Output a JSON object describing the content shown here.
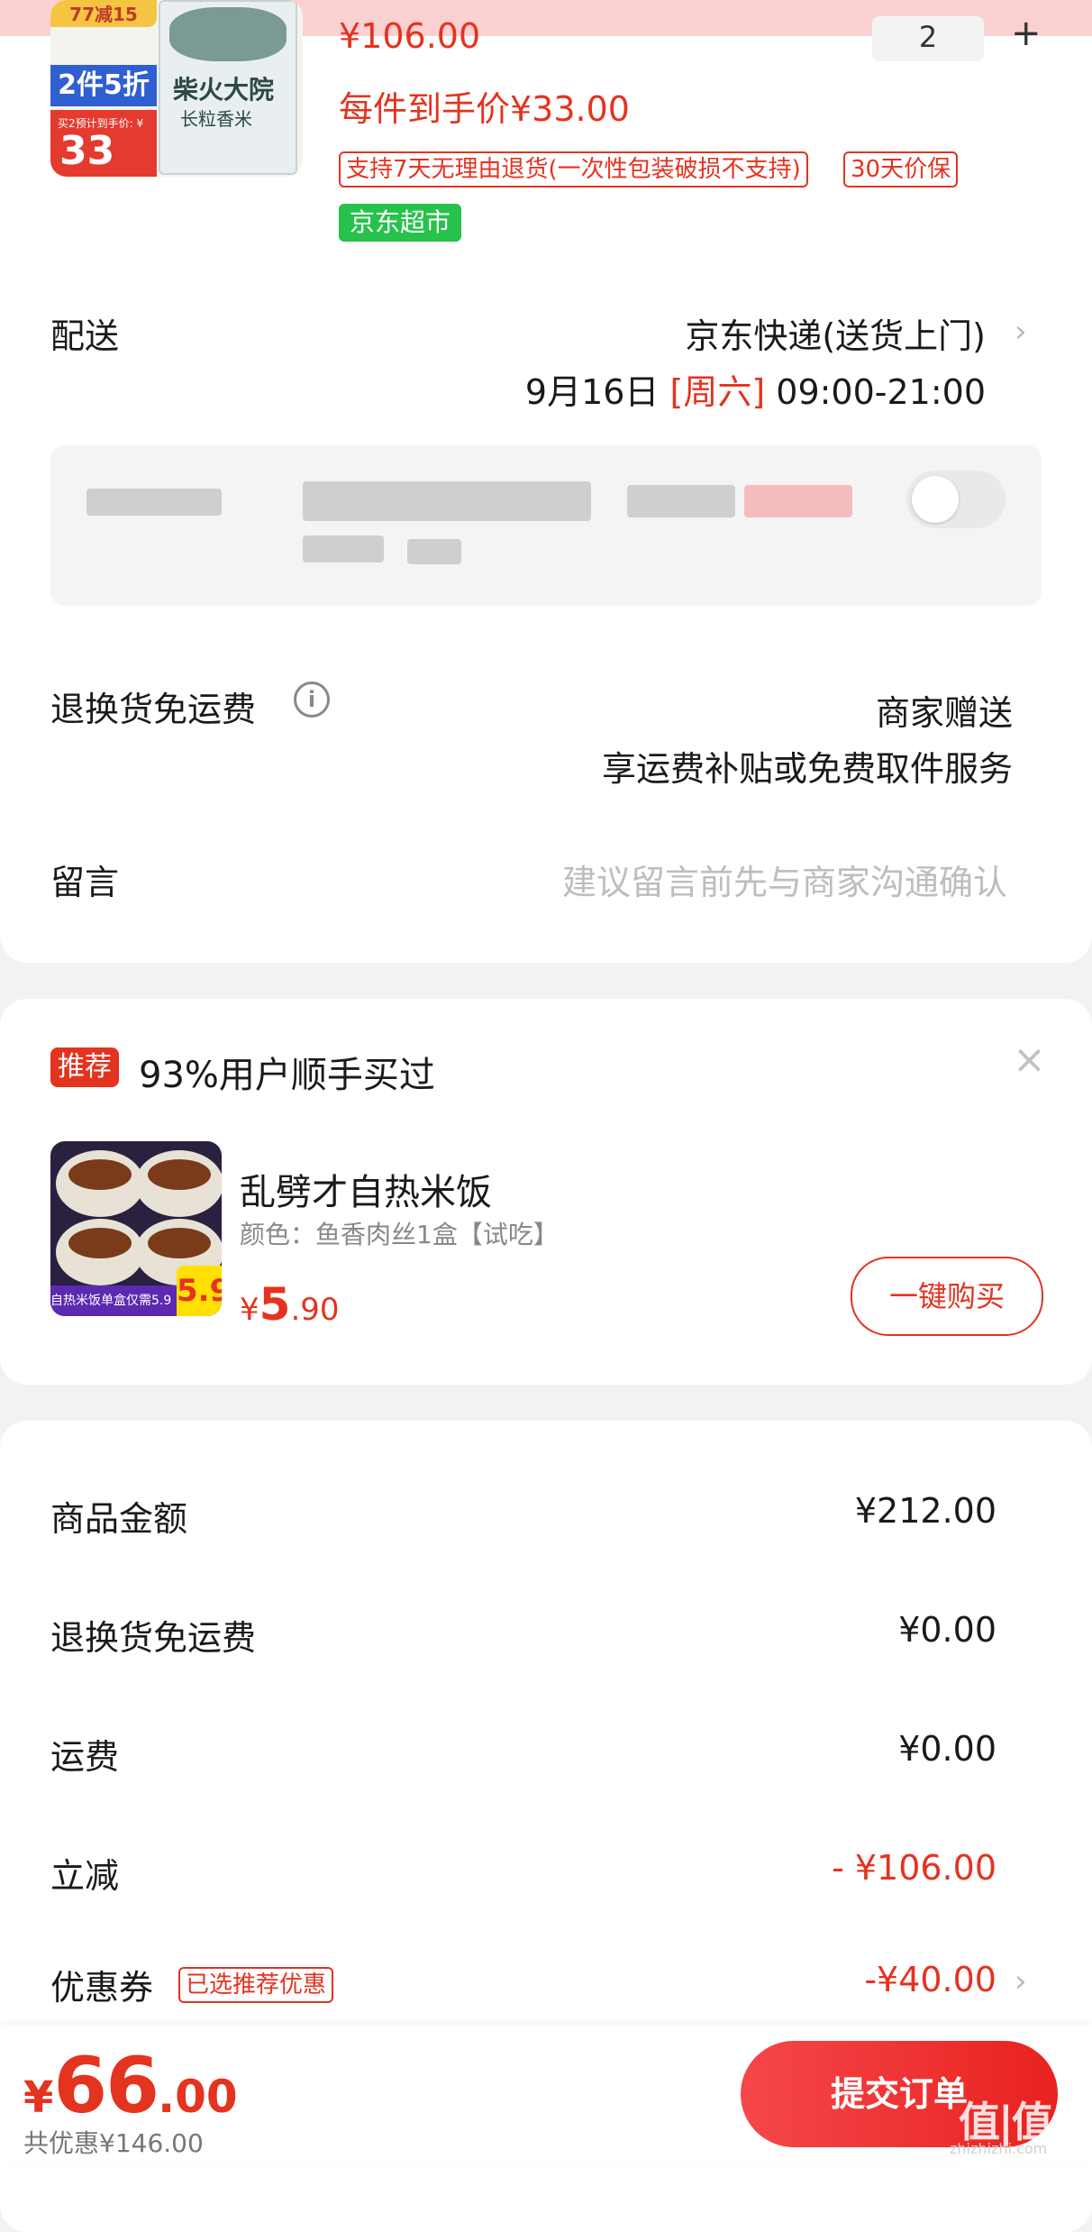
{
  "product": {
    "old_price": "¥106.00",
    "quantity": "2",
    "per_item_price": "每件到手价¥33.00",
    "tag_return": "支持7天无理由退货(一次性包装破损不支持)",
    "tag_price_protect": "30天价保",
    "tag_store": "京东超市",
    "image": {
      "badge_top": "77减15",
      "badge_discount": "2件5折",
      "badge_small": "买2预计到手价: ¥",
      "badge_price": "33",
      "brand": "柴火大院",
      "subtitle": "长粒香米"
    }
  },
  "delivery": {
    "label": "配送",
    "method": "京东快递(送货上门)",
    "date": "9月16日",
    "weekday": "[周六]",
    "time": "09:00-21:00"
  },
  "return_shipping": {
    "label": "退换货免运费",
    "value": "商家赠送",
    "desc": "享运费补贴或免费取件服务"
  },
  "message": {
    "label": "留言",
    "placeholder": "建议留言前先与商家沟通确认"
  },
  "recommend": {
    "badge": "推荐",
    "title": "93%用户顺手买过",
    "product_name": "乱劈才自热米饭",
    "product_variant": "颜色：鱼香肉丝1盒【试吃】",
    "price_symbol": "¥",
    "price_int": "5",
    "price_dec": ".90",
    "buy_label": "一键购买",
    "image_strip": "自热米饭单盒仅需5.9",
    "image_five": "5.9"
  },
  "summary": {
    "goods_label": "商品金额",
    "goods_amount": "¥212.00",
    "return_label": "退换货免运费",
    "return_amount": "¥0.00",
    "shipping_label": "运费",
    "shipping_amount": "¥0.00",
    "discount_label": "立减",
    "discount_amount": "- ¥106.00",
    "coupon_label": "优惠券",
    "coupon_tag": "已选推荐优惠",
    "coupon_amount": "-¥40.00"
  },
  "footer": {
    "total_symbol": "¥",
    "total_int": "66",
    "total_dec": ".00",
    "saved": "共优惠¥146.00",
    "submit_label": "提交订单",
    "watermark": "值|值|值",
    "watermark_site": "zhizhizhi.com"
  },
  "colors": {
    "accent": "#e4331f",
    "store_green": "#27c24c"
  }
}
